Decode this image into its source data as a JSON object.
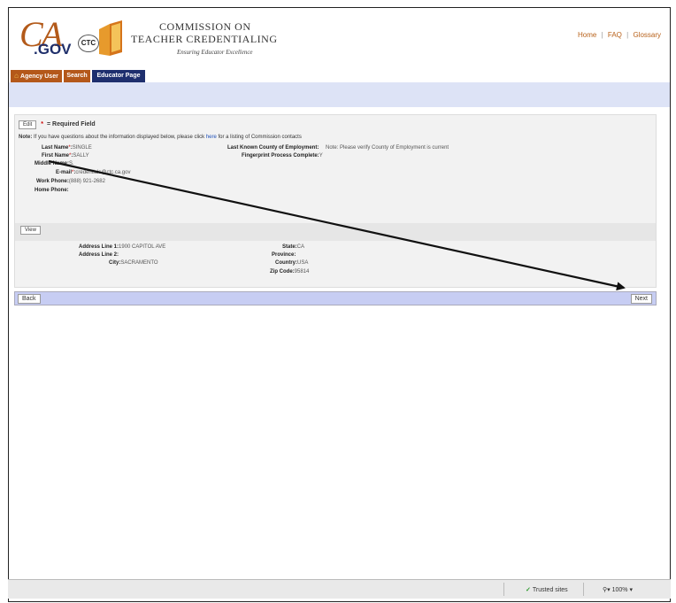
{
  "header": {
    "logo_ca": "CA",
    "logo_gov": ".GOV",
    "logo_ctc": "CTC",
    "org_line1": "COMMISSION ON",
    "org_line2": "TEACHER CREDENTIALING",
    "tagline": "Ensuring Educator Excellence",
    "links": {
      "home": "Home",
      "faq": "FAQ",
      "glossary": "Glossary",
      "separator": "|"
    }
  },
  "nav": {
    "tabs": [
      {
        "label": "Agency User"
      },
      {
        "label": "Search"
      },
      {
        "label": "Educator Page"
      }
    ]
  },
  "form": {
    "edit_label": "Edit",
    "required_star": "*",
    "required_text": "= Required Field",
    "note_label": "Note:",
    "note_text": " If you have questions about the information displayed below, please click ",
    "note_link": "here",
    "note_tail": " for a listing of Commission contacts",
    "fields": {
      "last_name": {
        "label": "Last Name",
        "star": "*",
        "value": "SINGLE"
      },
      "first_name": {
        "label": "First Name",
        "star": "*",
        "value": "SALLY"
      },
      "middle_name": {
        "label": "Middle Name:",
        "value": "S."
      },
      "email": {
        "label": "E-mail",
        "star": "*",
        "value": "credentials@ctc.ca.gov"
      },
      "work_phone": {
        "label": "Work Phone:",
        "value": "(888) 921-2682"
      },
      "home_phone": {
        "label": "Home Phone:",
        "value": ""
      },
      "county": {
        "label": "Last Known County of Employment:",
        "value": "Note: Please verify County of Employment is current"
      },
      "fingerprint": {
        "label": "Fingerprint Process Complete:",
        "value": "Y"
      }
    },
    "view_label": "View",
    "address": {
      "line1": {
        "label": "Address Line 1:",
        "value": "1900 CAPITOL AVE"
      },
      "line2": {
        "label": "Address Line 2:",
        "value": ""
      },
      "city": {
        "label": "City:",
        "value": "SACRAMENTO"
      },
      "state": {
        "label": "State:",
        "value": "CA"
      },
      "province": {
        "label": "Province:",
        "value": ""
      },
      "country": {
        "label": "Country:",
        "value": "USA"
      },
      "zip": {
        "label": "Zip Code:",
        "value": "95814"
      }
    },
    "back_label": "Back",
    "next_label": "Next"
  },
  "statusbar": {
    "trusted": "Trusted sites",
    "zoom": "100%"
  },
  "colors": {
    "brand_orange": "#b4581a",
    "brand_navy": "#1e2f6e",
    "bar_blue": "#c7cdf3",
    "link_orange": "#b8621b"
  }
}
